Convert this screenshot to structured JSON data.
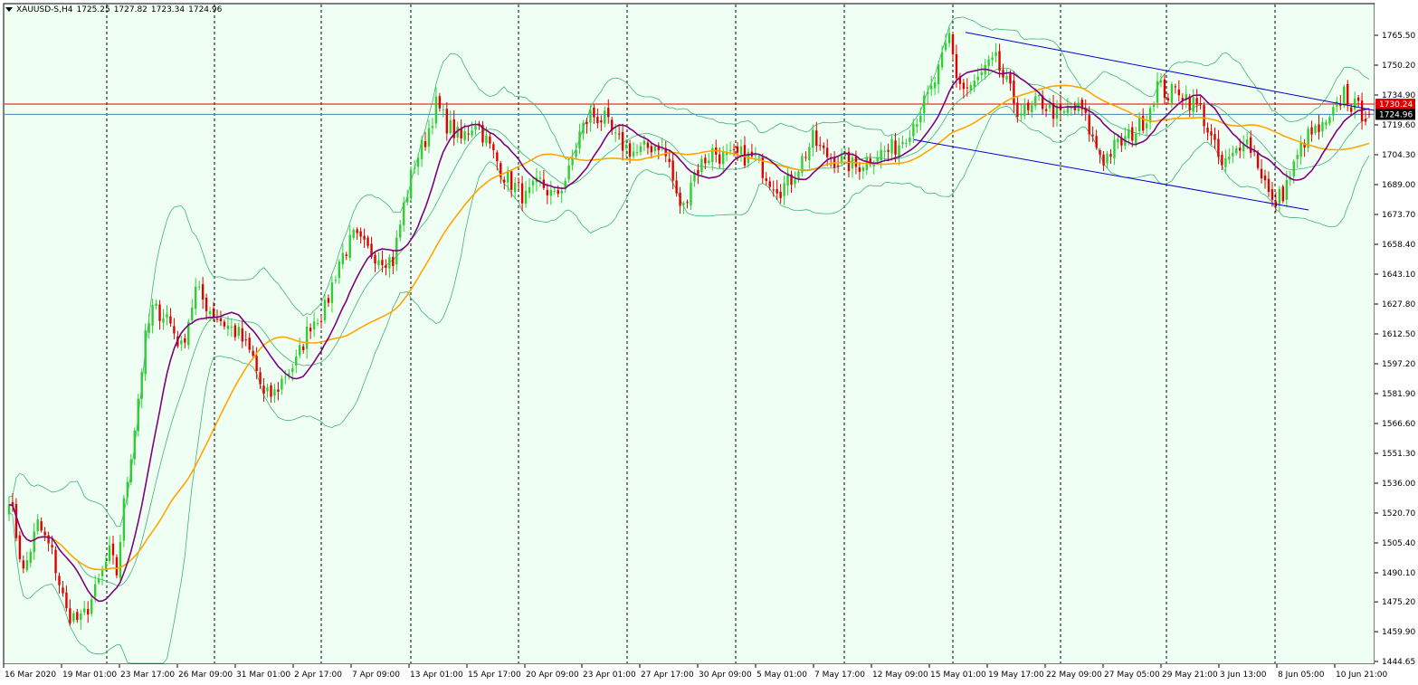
{
  "header": {
    "symbol": "XAUUSD-S,H4",
    "open": "1725.25",
    "high": "1727.82",
    "low": "1723.34",
    "close": "1724.96"
  },
  "colors": {
    "background": "#F0FFF4",
    "bull_candle": "#32CD32",
    "bear_candle": "#E00000",
    "bollinger": "#3CB371",
    "ma_fast": "#800080",
    "ma_slow": "#FFA500",
    "channel": "#0000CD",
    "h_red": "#E00000",
    "h_blue": "#4682B4",
    "price_label_red_bg": "#E00000",
    "price_label_black_bg": "#000000",
    "grid_vline": "#000000"
  },
  "price_labels": [
    {
      "text": "1730.24",
      "style": "red",
      "value": 1730.24
    },
    {
      "text": "1724.96",
      "style": "black",
      "value": 1724.96
    }
  ],
  "chart_data": {
    "type": "candlestick",
    "symbol": "XAUUSD-S",
    "timeframe": "H4",
    "y_axis": {
      "ticks": [
        "1765.50",
        "1750.20",
        "1734.90",
        "1719.60",
        "1704.30",
        "1689.00",
        "1673.70",
        "1658.40",
        "1643.10",
        "1627.80",
        "1612.50",
        "1597.20",
        "1581.90",
        "1566.60",
        "1551.30",
        "1536.00",
        "1520.70",
        "1505.40",
        "1490.10",
        "1475.20",
        "1459.90",
        "1444.65"
      ],
      "range": [
        1440,
        1773
      ]
    },
    "x_axis": {
      "ticks": [
        "16 Mar 2020",
        "19 Mar 01:00",
        "23 Mar 17:00",
        "26 Mar 09:00",
        "31 Mar 01:00",
        "2 Apr 17:00",
        "7 Apr 09:00",
        "13 Apr 01:00",
        "15 Apr 17:00",
        "20 Apr 09:00",
        "23 Apr 01:00",
        "27 Apr 17:00",
        "30 Apr 09:00",
        "5 May 01:00",
        "7 May 17:00",
        "12 May 09:00",
        "15 May 01:00",
        "19 May 17:00",
        "22 May 09:00",
        "27 May 05:00",
        "29 May 21:00",
        "3 Jun 13:00",
        "8 Jun 05:00",
        "10 Jun 21:00"
      ],
      "separator_ticks": [
        "19 Mar 01:00",
        "23 Mar 17:00",
        "31 Mar 01:00",
        "2 Apr 17:00",
        "13 Apr 01:00",
        "15 Apr 17:00",
        "23 Apr 01:00",
        "30 Apr 09:00",
        "7 May 17:00",
        "15 May 01:00",
        "22 May 09:00",
        "29 May 21:00",
        "8 Jun 05:00"
      ]
    },
    "price_anchors": [
      [
        0,
        1530
      ],
      [
        4,
        1490
      ],
      [
        8,
        1515
      ],
      [
        12,
        1500
      ],
      [
        16,
        1470
      ],
      [
        20,
        1465
      ],
      [
        24,
        1480
      ],
      [
        28,
        1500
      ],
      [
        30,
        1490
      ],
      [
        32,
        1525
      ],
      [
        35,
        1565
      ],
      [
        38,
        1610
      ],
      [
        40,
        1625
      ],
      [
        44,
        1622
      ],
      [
        48,
        1605
      ],
      [
        52,
        1635
      ],
      [
        56,
        1625
      ],
      [
        60,
        1618
      ],
      [
        64,
        1612
      ],
      [
        68,
        1600
      ],
      [
        71,
        1580
      ],
      [
        74,
        1582
      ],
      [
        77,
        1592
      ],
      [
        80,
        1598
      ],
      [
        84,
        1618
      ],
      [
        88,
        1625
      ],
      [
        92,
        1650
      ],
      [
        96,
        1662
      ],
      [
        100,
        1655
      ],
      [
        104,
        1652
      ],
      [
        107,
        1650
      ],
      [
        110,
        1678
      ],
      [
        113,
        1700
      ],
      [
        116,
        1712
      ],
      [
        119,
        1730
      ],
      [
        122,
        1720
      ],
      [
        126,
        1712
      ],
      [
        130,
        1722
      ],
      [
        134,
        1708
      ],
      [
        138,
        1694
      ],
      [
        141,
        1688
      ],
      [
        144,
        1682
      ],
      [
        148,
        1690
      ],
      [
        152,
        1682
      ],
      [
        156,
        1695
      ],
      [
        159,
        1715
      ],
      [
        162,
        1725
      ],
      [
        166,
        1722
      ],
      [
        169,
        1712
      ],
      [
        172,
        1708
      ],
      [
        175,
        1705
      ],
      [
        178,
        1708
      ],
      [
        181,
        1710
      ],
      [
        184,
        1700
      ],
      [
        186,
        1682
      ],
      [
        188,
        1677
      ],
      [
        190,
        1692
      ],
      [
        193,
        1700
      ],
      [
        196,
        1706
      ],
      [
        200,
        1702
      ],
      [
        204,
        1704
      ],
      [
        208,
        1702
      ],
      [
        212,
        1692
      ],
      [
        215,
        1687
      ],
      [
        218,
        1692
      ],
      [
        221,
        1702
      ],
      [
        224,
        1712
      ],
      [
        227,
        1705
      ],
      [
        230,
        1702
      ],
      [
        233,
        1700
      ],
      [
        236,
        1698
      ],
      [
        239,
        1702
      ],
      [
        242,
        1705
      ],
      [
        245,
        1706
      ],
      [
        248,
        1710
      ],
      [
        251,
        1718
      ],
      [
        254,
        1727
      ],
      [
        257,
        1737
      ],
      [
        260,
        1752
      ],
      [
        262,
        1765
      ],
      [
        264,
        1745
      ],
      [
        266,
        1738
      ],
      [
        269,
        1740
      ],
      [
        272,
        1748
      ],
      [
        275,
        1752
      ],
      [
        278,
        1740
      ],
      [
        281,
        1728
      ],
      [
        284,
        1725
      ],
      [
        287,
        1732
      ],
      [
        290,
        1728
      ],
      [
        293,
        1724
      ],
      [
        296,
        1728
      ],
      [
        299,
        1727
      ],
      [
        302,
        1712
      ],
      [
        305,
        1702
      ],
      [
        308,
        1708
      ],
      [
        311,
        1712
      ],
      [
        314,
        1717
      ],
      [
        317,
        1724
      ],
      [
        320,
        1740
      ],
      [
        323,
        1735
      ],
      [
        326,
        1738
      ],
      [
        329,
        1732
      ],
      [
        332,
        1728
      ],
      [
        335,
        1712
      ],
      [
        338,
        1698
      ],
      [
        341,
        1703
      ],
      [
        344,
        1714
      ],
      [
        347,
        1705
      ],
      [
        350,
        1690
      ],
      [
        352,
        1678
      ],
      [
        355,
        1685
      ],
      [
        358,
        1698
      ],
      [
        361,
        1712
      ],
      [
        364,
        1716
      ],
      [
        367,
        1718
      ],
      [
        370,
        1728
      ],
      [
        372,
        1737
      ],
      [
        374,
        1730
      ],
      [
        377,
        1726
      ],
      [
        379,
        1724.96
      ]
    ],
    "price_levels": [
      {
        "value": 1730.24,
        "color": "red"
      },
      {
        "value": 1724.96,
        "color": "blue"
      }
    ],
    "channel": {
      "upper": [
        [
          1067,
          1767
        ],
        [
          1519,
          1727
        ]
      ],
      "lower": [
        [
          1010,
          1712
        ],
        [
          1446,
          1676
        ]
      ]
    },
    "indicators": [
      "Bollinger Bands",
      "Moving Average (fast)",
      "Moving Average (slow)"
    ]
  }
}
